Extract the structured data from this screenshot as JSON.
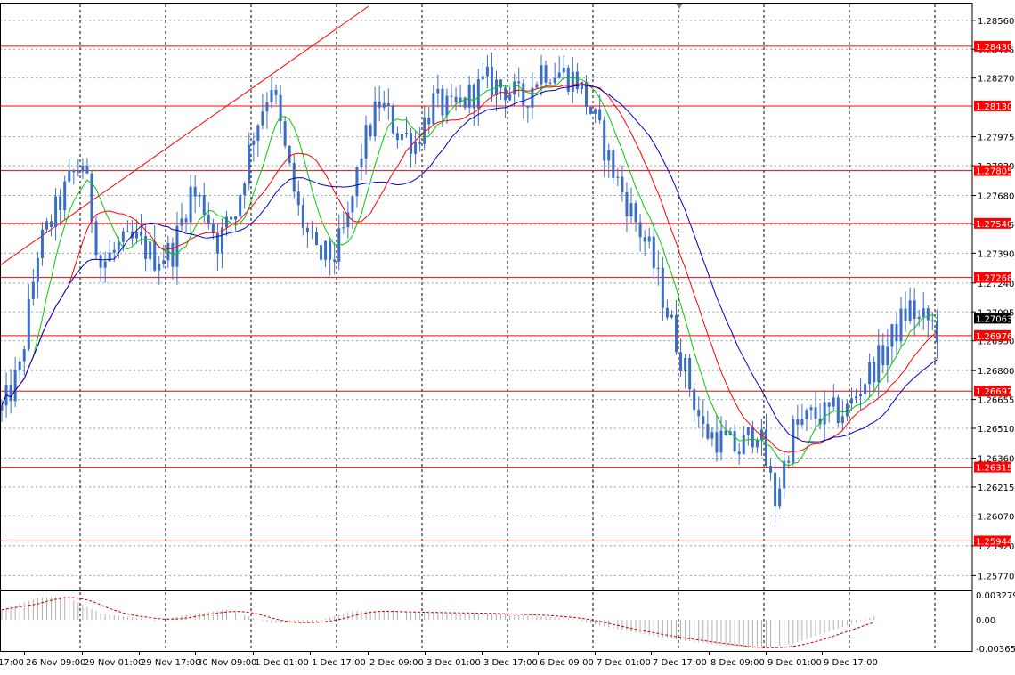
{
  "chart_data": {
    "type": "candlestick",
    "symbol": "GBPUSD",
    "price_axis": {
      "ylim": [
        1.257,
        1.2864
      ],
      "ticks": [
        "1.28560",
        "1.28415",
        "1.28270",
        "1.27975",
        "1.27830",
        "1.27680",
        "1.27535",
        "1.27390",
        "1.27240",
        "1.27095",
        "1.26950",
        "1.26800",
        "1.26655",
        "1.26510",
        "1.26360",
        "1.26215",
        "1.26070",
        "1.25920",
        "1.25770"
      ],
      "current_price": "1.27063"
    },
    "support_resistance_levels": [
      "1.28430",
      "1.28130",
      "1.27805",
      "1.27540",
      "1.27268",
      "1.26976",
      "1.26697",
      "1.26315",
      "1.25944"
    ],
    "time_axis": {
      "labels": [
        "17:00",
        "26 Nov 09:00",
        "29 Nov 01:00",
        "29 Nov 17:00",
        "30 Nov 09:00",
        "1 Dec 01:00",
        "1 Dec 17:00",
        "2 Dec 09:00",
        "3 Dec 01:00",
        "3 Dec 17:00",
        "6 Dec 09:00",
        "7 Dec 01:00",
        "7 Dec 17:00",
        "8 Dec 09:00",
        "9 Dec 01:00",
        "9 Dec 17:00"
      ]
    },
    "price_keypoints": [
      [
        0,
        1.266
      ],
      [
        4,
        1.268
      ],
      [
        8,
        1.274
      ],
      [
        12,
        1.276
      ],
      [
        15,
        1.2775
      ],
      [
        18,
        1.2785
      ],
      [
        22,
        1.2733
      ],
      [
        26,
        1.2742
      ],
      [
        30,
        1.2745
      ],
      [
        34,
        1.2737
      ],
      [
        38,
        1.274
      ],
      [
        42,
        1.277
      ],
      [
        45,
        1.2763
      ],
      [
        48,
        1.2745
      ],
      [
        52,
        1.276
      ],
      [
        56,
        1.28
      ],
      [
        60,
        1.2825
      ],
      [
        63,
        1.279
      ],
      [
        66,
        1.276
      ],
      [
        70,
        1.2737
      ],
      [
        74,
        1.2738
      ],
      [
        77,
        1.2755
      ],
      [
        80,
        1.279
      ],
      [
        84,
        1.2815
      ],
      [
        88,
        1.28
      ],
      [
        92,
        1.2795
      ],
      [
        96,
        1.2815
      ],
      [
        100,
        1.281
      ],
      [
        104,
        1.2818
      ],
      [
        108,
        1.2825
      ],
      [
        112,
        1.2822
      ],
      [
        116,
        1.2815
      ],
      [
        120,
        1.2832
      ],
      [
        124,
        1.283
      ],
      [
        128,
        1.2826
      ],
      [
        132,
        1.2805
      ],
      [
        136,
        1.278
      ],
      [
        140,
        1.276
      ],
      [
        144,
        1.274
      ],
      [
        148,
        1.271
      ],
      [
        152,
        1.268
      ],
      [
        156,
        1.265
      ],
      [
        160,
        1.2645
      ],
      [
        164,
        1.264
      ],
      [
        168,
        1.2652
      ],
      [
        172,
        1.2615
      ],
      [
        176,
        1.265
      ],
      [
        180,
        1.2657
      ],
      [
        184,
        1.2658
      ],
      [
        188,
        1.266
      ],
      [
        192,
        1.2676
      ],
      [
        196,
        1.2688
      ],
      [
        200,
        1.2705
      ],
      [
        202,
        1.2712
      ],
      [
        204,
        1.2705
      ],
      [
        206,
        1.2705
      ],
      [
        208,
        1.27
      ]
    ],
    "moving_averages": [
      {
        "color": "#00cc00",
        "period": 8
      },
      {
        "color": "#ff0000",
        "period": 16
      },
      {
        "color": "#0000cc",
        "period": 26
      }
    ],
    "oscillator": {
      "ticks": [
        "0.003279",
        "0.00",
        "-0.003654"
      ],
      "ylim": [
        -0.003654,
        0.003279
      ],
      "keypoints": [
        [
          0,
          0.0012
        ],
        [
          8,
          0.0026
        ],
        [
          14,
          0.0028
        ],
        [
          22,
          0.0008
        ],
        [
          34,
          -0.0001
        ],
        [
          42,
          0.0007
        ],
        [
          50,
          0.0012
        ],
        [
          60,
          -0.0004
        ],
        [
          70,
          -0.0002
        ],
        [
          78,
          0.0011
        ],
        [
          90,
          0.0009
        ],
        [
          104,
          0.0008
        ],
        [
          116,
          0.0006
        ],
        [
          126,
          0.0002
        ],
        [
          136,
          -0.001
        ],
        [
          146,
          -0.002
        ],
        [
          160,
          -0.003
        ],
        [
          168,
          -0.0034
        ],
        [
          176,
          -0.0028
        ],
        [
          186,
          -0.001
        ],
        [
          196,
          0.0008
        ],
        [
          204,
          0.0012
        ],
        [
          208,
          0.001
        ]
      ]
    },
    "colors": {
      "candle": "#3a6ec4",
      "level_line": "#ff0000",
      "level_label_bg": "#ff0000",
      "current_label_bg": "#000000",
      "grid": "#9aa0a6",
      "trend_line": "#ff0000"
    }
  }
}
